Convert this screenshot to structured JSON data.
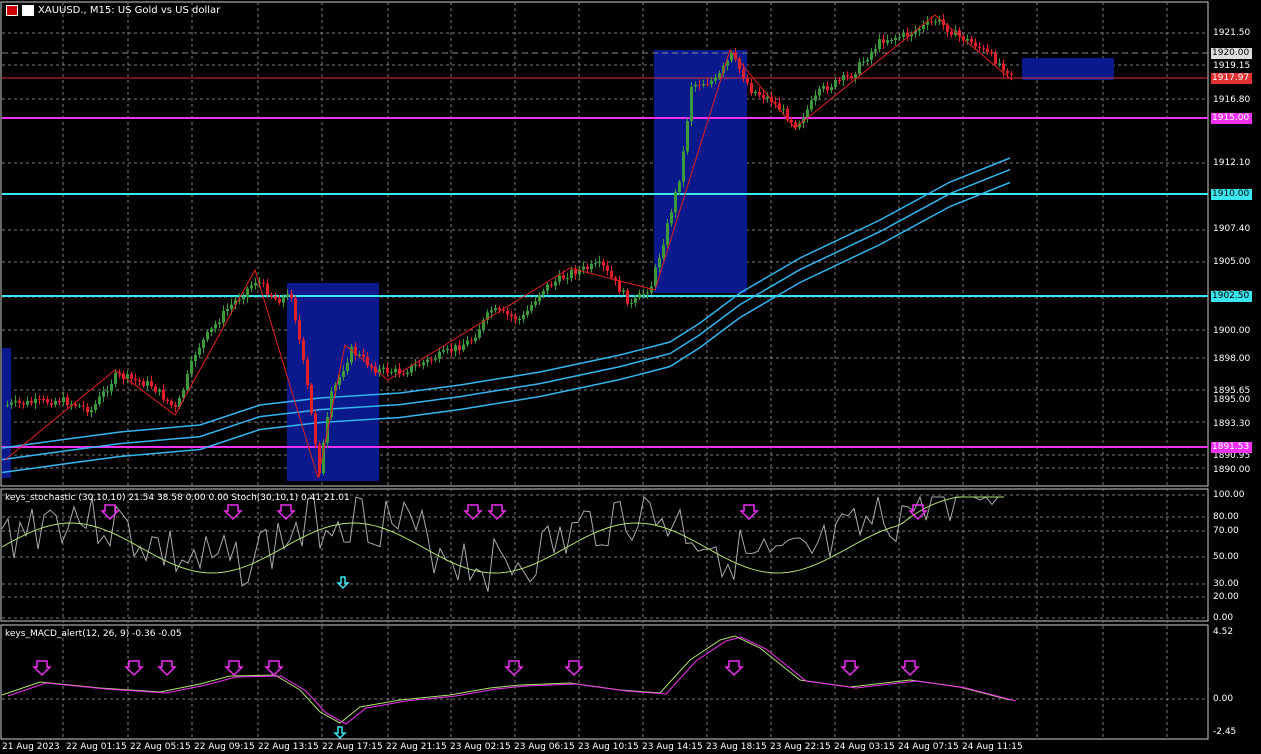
{
  "window": {
    "symbol": "XAUUSD.",
    "timeframe": "M15",
    "description": "US Gold vs US dollar",
    "title_text": "XAUUSD., M15:  US Gold vs US dollar"
  },
  "colors": {
    "background": "#000000",
    "bull": "#3c9a3c",
    "bear": "#e0202a",
    "ma": "#33b5f0",
    "cyan_level": "#3ae6f0",
    "magenta_level": "#f030f0",
    "zone": "#0a1a8c",
    "grid": "#7a7a7a"
  },
  "price_axis": {
    "labels": [
      "1921.50",
      "1919.15",
      "1916.80",
      "1912.10",
      "1907.40",
      "1905.00",
      "1902.50",
      "1900.00",
      "1898.00",
      "1895.65",
      "1895.00",
      "1893.30",
      "1890.95",
      "1890.00"
    ],
    "tags": [
      {
        "text": "1920.00",
        "style": "gray"
      },
      {
        "text": "1917.97",
        "style": "red"
      },
      {
        "text": "1915.00",
        "style": "magenta"
      },
      {
        "text": "1910.00",
        "style": "cyan"
      },
      {
        "text": "1902.50",
        "style": "cyan"
      },
      {
        "text": "1891.53",
        "style": "magenta"
      }
    ]
  },
  "stoch_axis": [
    "100.00",
    "80.00",
    "70.00",
    "50.00",
    "30.00",
    "20.00",
    "0.00"
  ],
  "macd_axis": [
    "4.52",
    "0.00",
    "-2.45"
  ],
  "indicators": {
    "stoch_title": "keys_stochastic (30,10,10) 21.54 38.58 0.00 0.00 Stoch(30,10,1) 0.41 21.01",
    "macd_title": "keys_MACD_alert(12, 26, 9) -0.36 -0.05"
  },
  "time_axis": [
    "21 Aug 2023",
    "22 Aug 01:15",
    "22 Aug 05:15",
    "22 Aug 09:15",
    "22 Aug 13:15",
    "22 Aug 17:15",
    "22 Aug 21:15",
    "23 Aug 02:15",
    "23 Aug 06:15",
    "23 Aug 10:15",
    "23 Aug 14:15",
    "23 Aug 18:15",
    "23 Aug 22:15",
    "24 Aug 03:15",
    "24 Aug 07:15",
    "24 Aug 11:15"
  ]
}
